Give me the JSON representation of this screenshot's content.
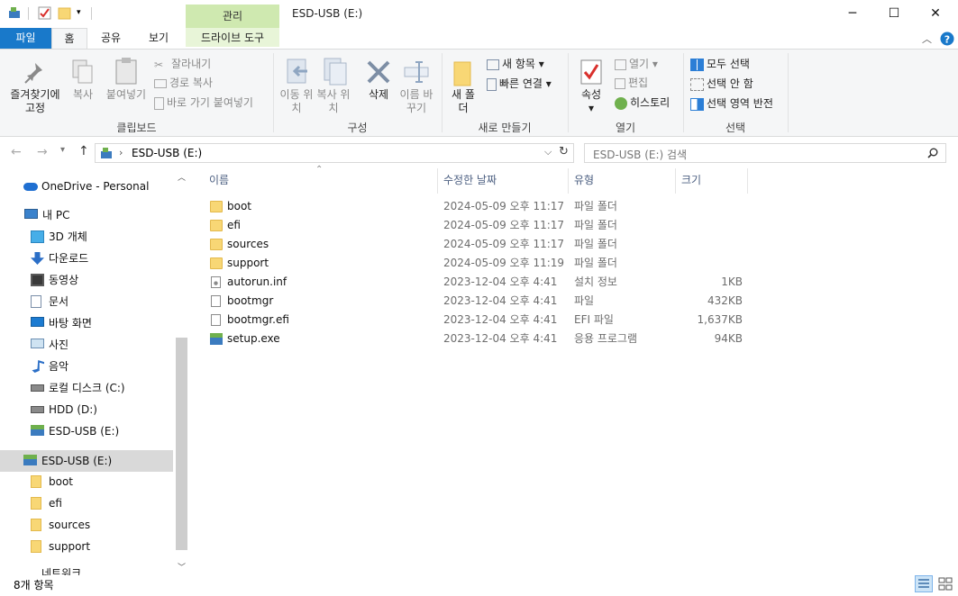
{
  "window": {
    "title": "ESD-USB (E:)",
    "context_tab": "관리"
  },
  "window_controls": {
    "minimize": "─",
    "maximize": "☐",
    "close": "✕"
  },
  "tabs": {
    "file": "파일",
    "home": "홈",
    "share": "공유",
    "view": "보기",
    "drive_tools": "드라이브 도구"
  },
  "ribbon": {
    "clipboard": {
      "pin": "즐겨찾기에 고정",
      "copy": "복사",
      "paste": "붙여넣기",
      "cut": "잘라내기",
      "copy_path": "경로 복사",
      "paste_shortcut": "바로 가기 붙여넣기",
      "label": "클립보드"
    },
    "organize": {
      "move_to": "이동 위치",
      "copy_to": "복사 위치",
      "delete": "삭제",
      "rename": "이름 바꾸기",
      "label": "구성"
    },
    "new": {
      "new_folder": "새 폴더",
      "new_item": "새 항목",
      "easy_access": "빠른 연결",
      "label": "새로 만들기"
    },
    "open": {
      "properties": "속성",
      "open": "열기",
      "edit": "편집",
      "history": "히스토리",
      "label": "열기"
    },
    "select": {
      "select_all": "모두 선택",
      "select_none": "선택 안 함",
      "invert": "선택 영역 반전",
      "label": "선택"
    }
  },
  "address": {
    "path_icon": "usb-drive-icon",
    "path": "ESD-USB (E:)",
    "search_placeholder": "ESD-USB (E:) 검색"
  },
  "nav": {
    "items": [
      {
        "label": "OneDrive - Personal",
        "icon": "cloud-icon"
      },
      {
        "label": "내 PC",
        "icon": "pc-icon"
      },
      {
        "label": "3D 개체",
        "icon": "cube-icon"
      },
      {
        "label": "다운로드",
        "icon": "download-icon"
      },
      {
        "label": "동영상",
        "icon": "video-icon"
      },
      {
        "label": "문서",
        "icon": "document-icon"
      },
      {
        "label": "바탕 화면",
        "icon": "desktop-icon"
      },
      {
        "label": "사진",
        "icon": "pictures-icon"
      },
      {
        "label": "음악",
        "icon": "music-icon"
      },
      {
        "label": "로컬 디스크 (C:)",
        "icon": "disk-icon"
      },
      {
        "label": "HDD (D:)",
        "icon": "disk-icon"
      },
      {
        "label": "ESD-USB (E:)",
        "icon": "usb-drive-icon"
      },
      {
        "label": "ESD-USB (E:)",
        "icon": "usb-drive-icon"
      },
      {
        "label": "boot",
        "icon": "folder-icon"
      },
      {
        "label": "efi",
        "icon": "folder-icon"
      },
      {
        "label": "sources",
        "icon": "folder-icon"
      },
      {
        "label": "support",
        "icon": "folder-icon"
      },
      {
        "label": "네트워크",
        "icon": "network-icon"
      }
    ]
  },
  "columns": {
    "name": "이름",
    "modified": "수정한 날짜",
    "type": "유형",
    "size": "크기"
  },
  "files": [
    {
      "name": "boot",
      "modified": "2024-05-09 오후 11:17",
      "type": "파일 폴더",
      "size": "",
      "icon": "folder-icon"
    },
    {
      "name": "efi",
      "modified": "2024-05-09 오후 11:17",
      "type": "파일 폴더",
      "size": "",
      "icon": "folder-icon"
    },
    {
      "name": "sources",
      "modified": "2024-05-09 오후 11:17",
      "type": "파일 폴더",
      "size": "",
      "icon": "folder-icon"
    },
    {
      "name": "support",
      "modified": "2024-05-09 오후 11:19",
      "type": "파일 폴더",
      "size": "",
      "icon": "folder-icon"
    },
    {
      "name": "autorun.inf",
      "modified": "2023-12-04 오후 4:41",
      "type": "설치 정보",
      "size": "1KB",
      "icon": "settings-file-icon"
    },
    {
      "name": "bootmgr",
      "modified": "2023-12-04 오후 4:41",
      "type": "파일",
      "size": "432KB",
      "icon": "file-icon"
    },
    {
      "name": "bootmgr.efi",
      "modified": "2023-12-04 오후 4:41",
      "type": "EFI 파일",
      "size": "1,637KB",
      "icon": "file-icon"
    },
    {
      "name": "setup.exe",
      "modified": "2023-12-04 오후 4:41",
      "type": "응용 프로그램",
      "size": "94KB",
      "icon": "setup-icon"
    }
  ],
  "status": {
    "count": "8개 항목"
  },
  "colors": {
    "file_tab": "#1979ca",
    "context_tab": "#cfe9b0",
    "folder": "#f8d775",
    "selection": "#d9d9d9"
  }
}
